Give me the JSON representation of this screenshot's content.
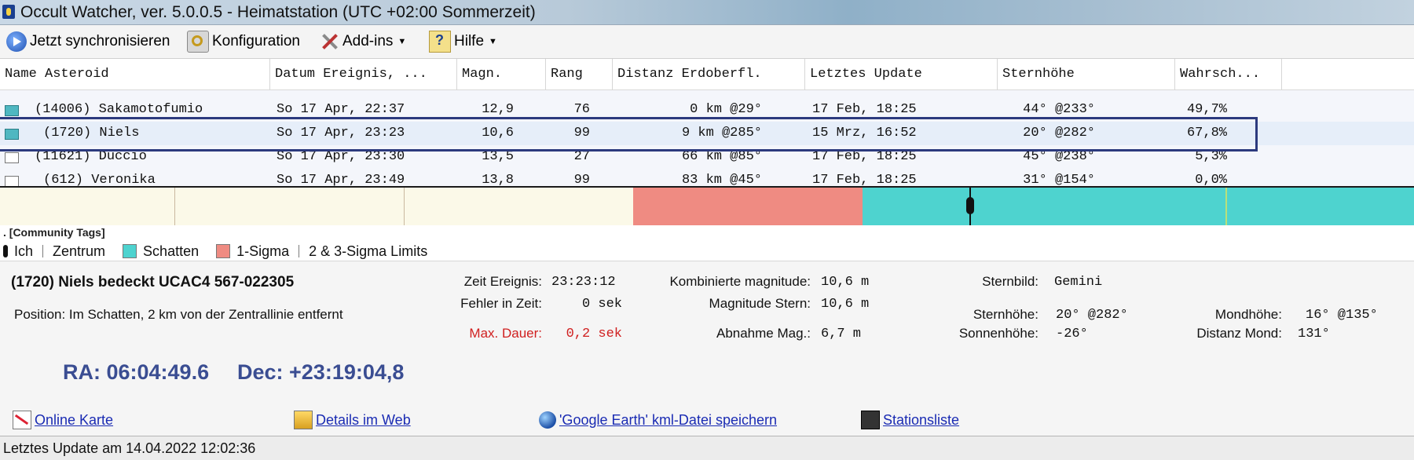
{
  "window": {
    "title": "Occult Watcher, ver. 5.0.0.5 - Heimatstation (UTC +02:00 Sommerzeit)"
  },
  "menu": {
    "sync": "Jetzt synchronisieren",
    "config": "Konfiguration",
    "addins": "Add-ins",
    "help": "Hilfe"
  },
  "table": {
    "columns": [
      "Name Asteroid",
      "Datum Ereignis, ...",
      "Magn.",
      "Rang",
      "Distanz Erdoberfl.",
      "Letztes Update",
      "Sternhöhe",
      "Wahrsch..."
    ],
    "rows": [
      {
        "name": "(14006) Sakamotofumio",
        "date": "So 17 Apr, 22:37",
        "mag": "12,9",
        "rank": "76",
        "dist": "0 km @29°",
        "updated": "17 Feb, 18:25",
        "alt": "44° @233°",
        "prob": "49,7%",
        "checked": true
      },
      {
        "name": "(1720) Niels",
        "date": "So 17 Apr, 23:23",
        "mag": "10,6",
        "rank": "99",
        "dist": "9 km @285°",
        "updated": "15 Mrz, 16:52",
        "alt": "20° @282°",
        "prob": "67,8%",
        "checked": true
      },
      {
        "name": "(11621) Duccio",
        "date": "So 17 Apr, 23:30",
        "mag": "13,5",
        "rank": "27",
        "dist": "66 km @85°",
        "updated": "17 Feb, 18:25",
        "alt": "45° @238°",
        "prob": "5,3%",
        "checked": false
      },
      {
        "name": "(612) Veronika",
        "date": "So 17 Apr, 23:49",
        "mag": "13,8",
        "rank": "99",
        "dist": "83 km @45°",
        "updated": "17 Feb, 18:25",
        "alt": "31° @154°",
        "prob": "0,0%",
        "checked": false
      }
    ]
  },
  "legend": {
    "tags": ". [Community Tags]",
    "me": "Ich",
    "center": "Zentrum",
    "shadow": "Schatten",
    "sigma1": "1-Sigma",
    "sigma23": "2 & 3-Sigma Limits"
  },
  "event": {
    "headline": "(1720) Niels bedeckt  UCAC4 567-022305",
    "position": "Position:  Im Schatten, 2 km von der Zentrallinie entfernt",
    "time_label": "Zeit Ereignis:",
    "time": "23:23:12",
    "error_label": "Fehler in Zeit:",
    "error": "0 sek",
    "maxdur_label": "Max. Dauer:",
    "maxdur": "0,2 sek",
    "combmag_label": "Kombinierte magnitude:",
    "combmag": "10,6 m",
    "starmag_label": "Magnitude Stern:",
    "starmag": "10,6 m",
    "drop_label": "Abnahme Mag.:",
    "drop": "6,7 m",
    "constellation_label": "Sternbild:",
    "constellation": "Gemini",
    "staralt_label": "Sternhöhe:",
    "staralt": "20° @282°",
    "sunalt_label": "Sonnenhöhe:",
    "sunalt": "-26°",
    "moonalt_label": "Mondhöhe:",
    "moonalt": "16° @135°",
    "moondist_label": "Distanz Mond:",
    "moondist": "131°",
    "ra": "RA:   06:04:49.6",
    "dec": "Dec:   +23:19:04,8"
  },
  "links": {
    "map": "Online Karte",
    "web": "Details im Web",
    "earth": "'Google Earth' kml-Datei speichern",
    "stations": "Stationsliste"
  },
  "status": {
    "text": "Letztes Update am 14.04.2022 12:02:36"
  },
  "colors": {
    "shadow": "#4ed3cf",
    "sigma1": "#ef8b82",
    "selection": "#2c3a7e",
    "radec": "#3a4d92"
  }
}
